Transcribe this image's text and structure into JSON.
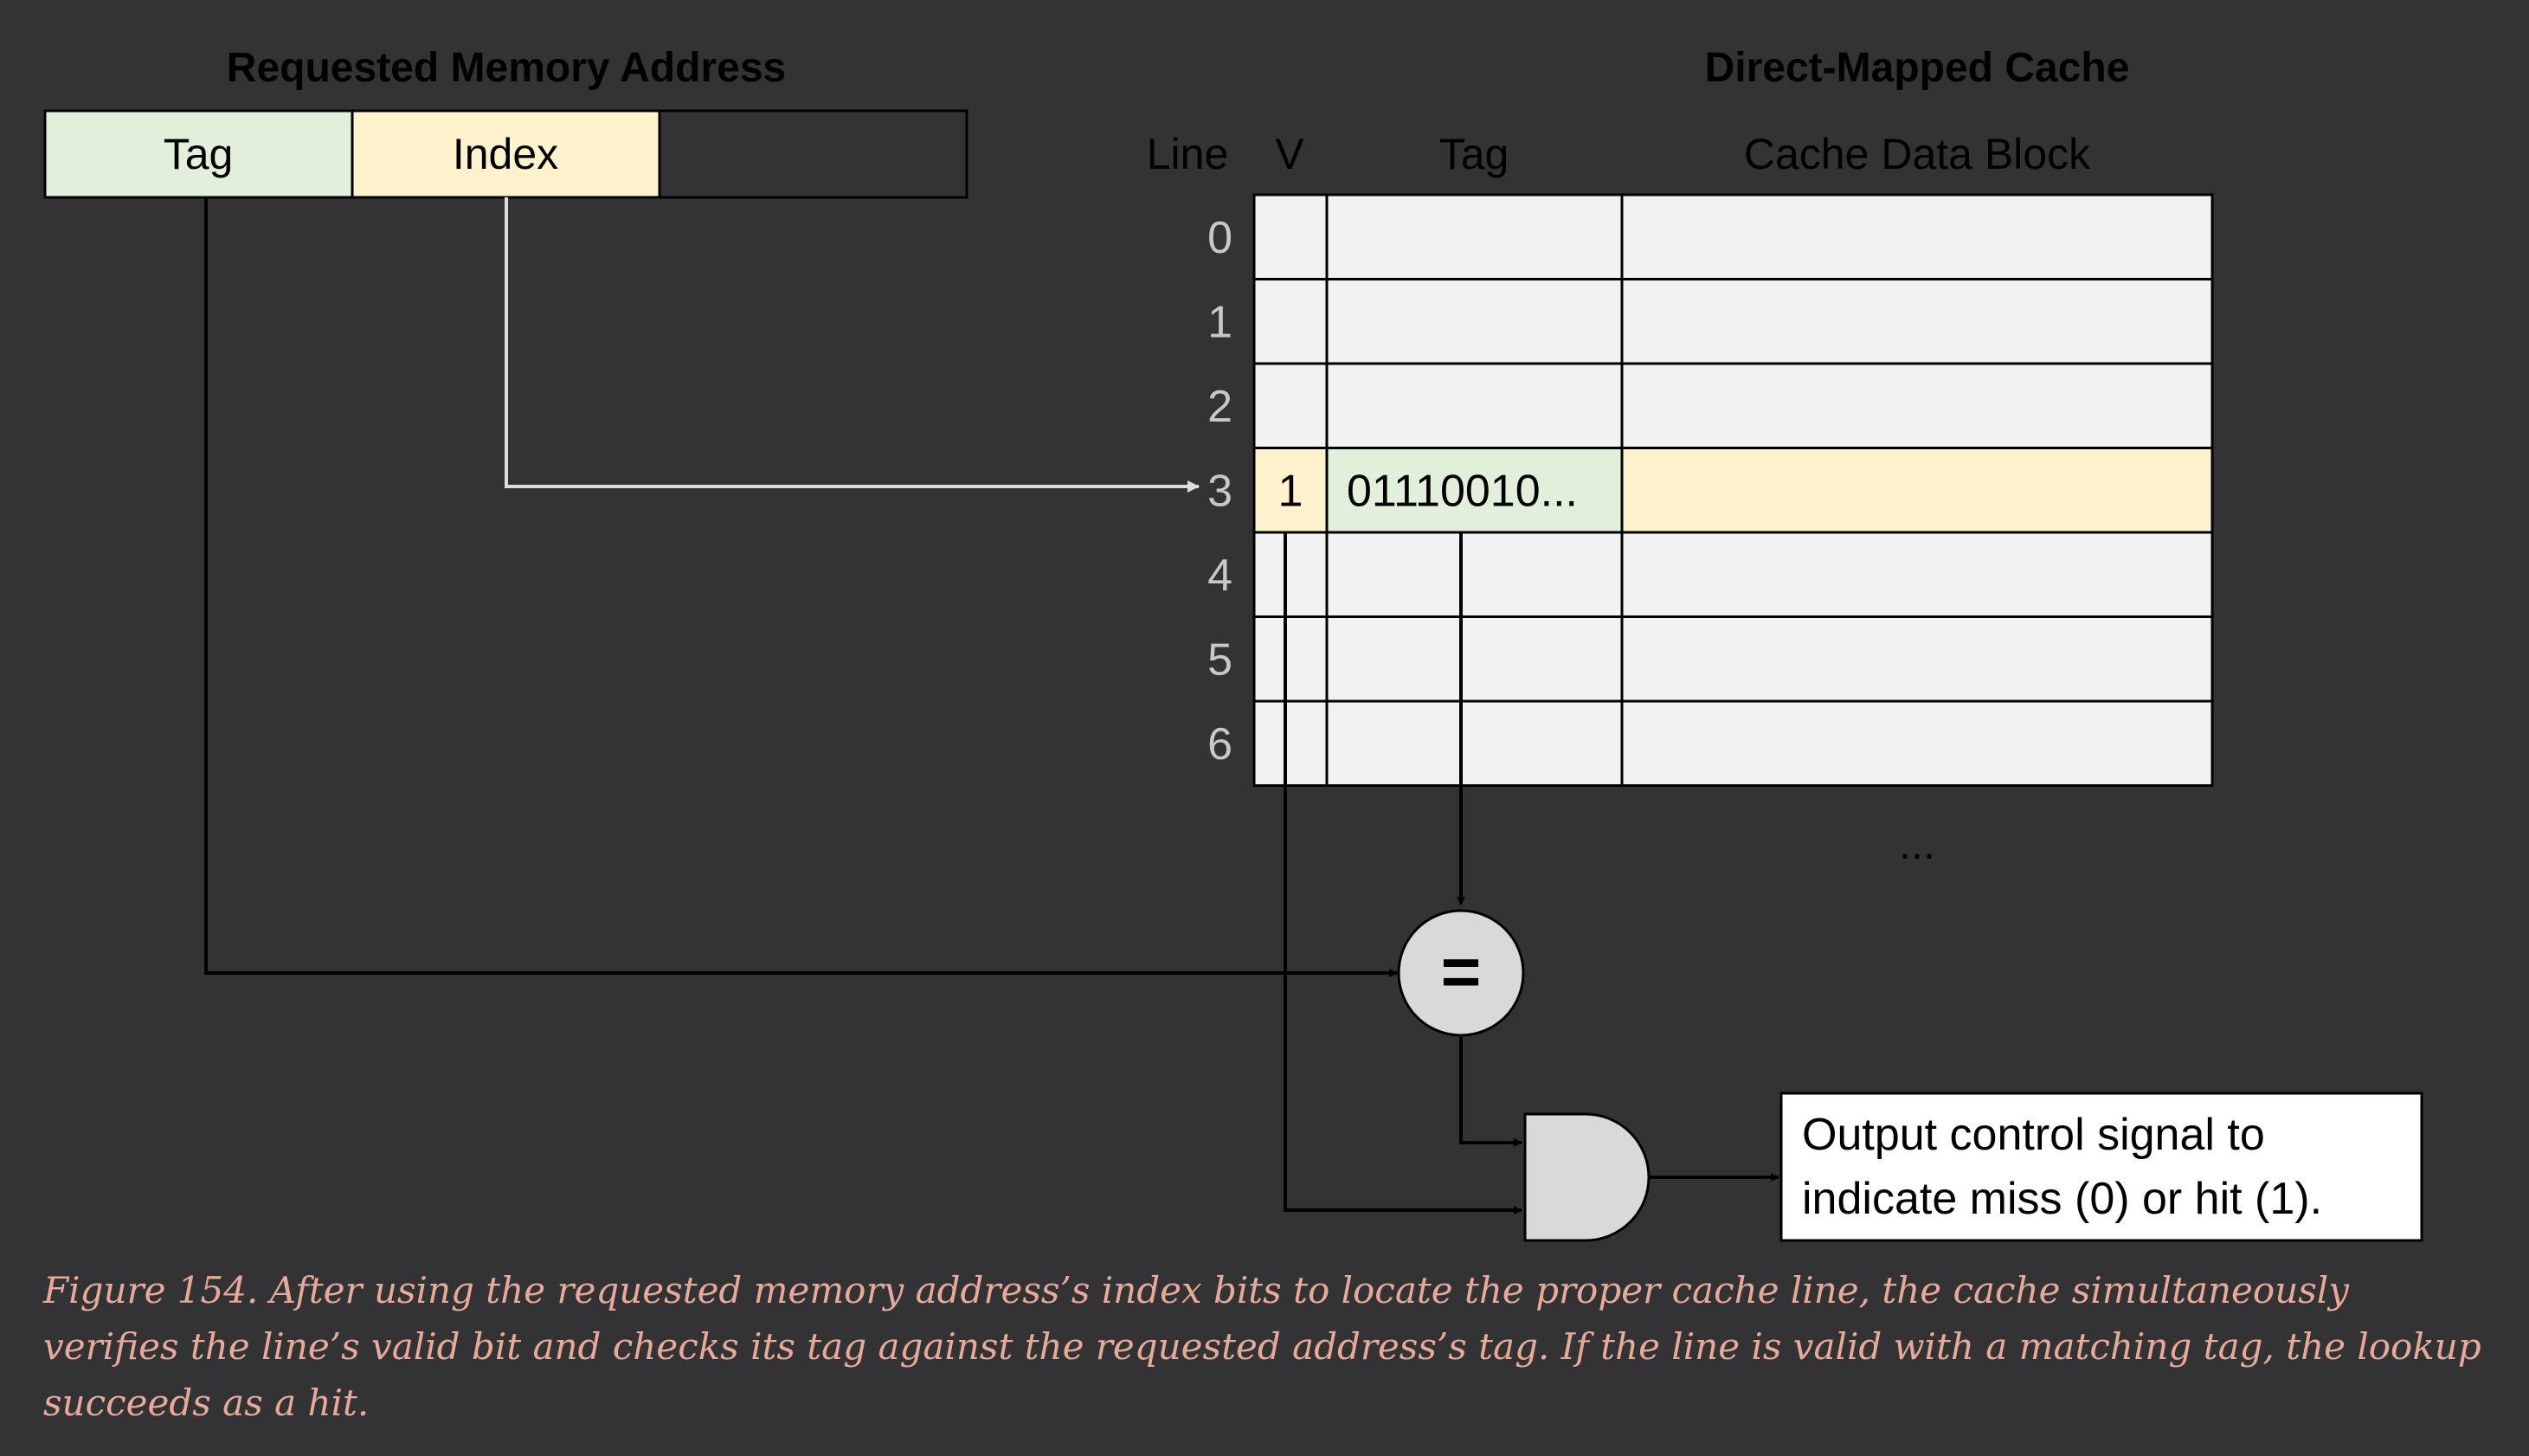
{
  "address": {
    "title": "Requested Memory Address",
    "fields": {
      "tag": "Tag",
      "index": "Index",
      "offset": ""
    }
  },
  "cache": {
    "title": "Direct-Mapped Cache",
    "headers": {
      "line": "Line",
      "valid": "V",
      "tag": "Tag",
      "data": "Cache Data Block"
    },
    "rows": [
      {
        "line": "0",
        "valid": "",
        "tag": ""
      },
      {
        "line": "1",
        "valid": "",
        "tag": ""
      },
      {
        "line": "2",
        "valid": "",
        "tag": ""
      },
      {
        "line": "3",
        "valid": "1",
        "tag": "01110010...",
        "highlight": true
      },
      {
        "line": "4",
        "valid": "",
        "tag": ""
      },
      {
        "line": "5",
        "valid": "",
        "tag": ""
      },
      {
        "line": "6",
        "valid": "",
        "tag": ""
      }
    ],
    "ellipsis": "..."
  },
  "comparator": {
    "symbol": "="
  },
  "output": {
    "lines": [
      "Output control signal to",
      "indicate miss (0) or hit (1)."
    ]
  },
  "caption": "Figure 154. After using the requested memory address’s index bits to locate the proper cache line, the cache simultaneously verifies the line’s valid bit and checks its tag against the requested address’s tag. If the line is valid with a matching tag, the lookup succeeds as a hit.",
  "colors": {
    "background": "#333335",
    "tag_green": "#e2efda",
    "index_yellow": "#fff2cc",
    "cell_grey": "#f2f2f2",
    "gate_grey": "#d9d9d9",
    "white_wire": "#dddddd",
    "caption": "#e7aa98"
  }
}
